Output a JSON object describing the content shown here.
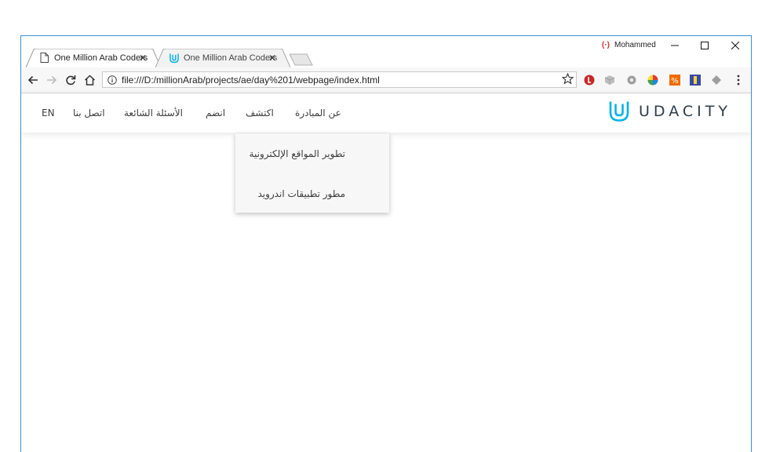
{
  "browser": {
    "tabs": [
      {
        "title": "One Million Arab Coders",
        "close": "✕",
        "active": true
      },
      {
        "title": "One Million Arab Coders",
        "close": "✕",
        "active": false
      }
    ],
    "user": {
      "name": "Mohammed"
    },
    "window_controls": {
      "minimize": "—",
      "maximize": "☐",
      "close": "✕"
    },
    "address_bar": {
      "url": "file:///D:/millionArab/projects/ae/day%201/webpage/index.html"
    },
    "colors": {
      "accent": "#02b3e4",
      "window_border": "#3c8fd6"
    }
  },
  "site": {
    "nav": {
      "lang": "EN",
      "contact": "اتصل بنا",
      "faq": "الأسئلة الشائعة",
      "join": "انضم",
      "explore": "اكتشف",
      "about": "عن المبادرة"
    },
    "logo_text": "UDACITY",
    "dropdown": [
      {
        "label": "تطوير المواقع الإلكترونية"
      },
      {
        "label": "مطور تطبيقات اندرويد"
      }
    ]
  }
}
